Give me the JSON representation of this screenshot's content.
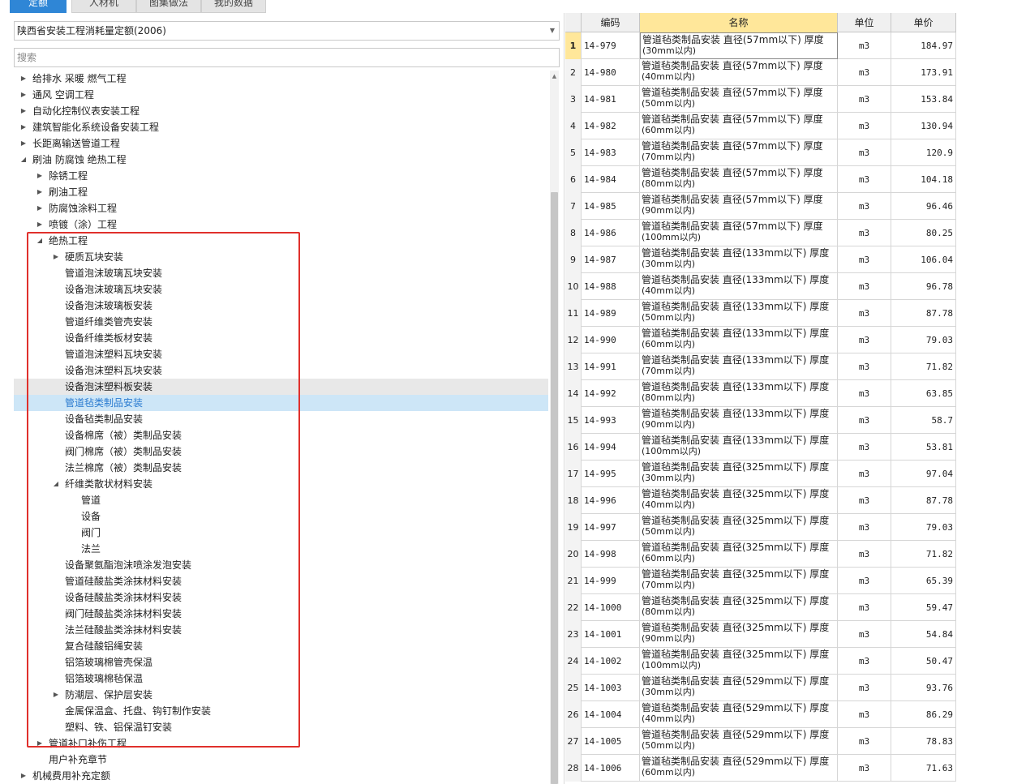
{
  "tabs": [
    {
      "label": "定额",
      "active": true
    },
    {
      "label": "人材机",
      "active": false
    },
    {
      "label": "图集做法",
      "active": false
    },
    {
      "label": "我的数据",
      "active": false
    }
  ],
  "dropdown": {
    "value": "陕西省安装工程消耗量定额(2006)"
  },
  "search": {
    "placeholder": "搜索"
  },
  "tree": [
    {
      "label": "给排水 采暖 燃气工程",
      "level": 0,
      "toggle": "collapsed"
    },
    {
      "label": "通风 空调工程",
      "level": 0,
      "toggle": "collapsed"
    },
    {
      "label": "自动化控制仪表安装工程",
      "level": 0,
      "toggle": "collapsed"
    },
    {
      "label": "建筑智能化系统设备安装工程",
      "level": 0,
      "toggle": "collapsed"
    },
    {
      "label": "长距离输送管道工程",
      "level": 0,
      "toggle": "collapsed"
    },
    {
      "label": "刷油 防腐蚀 绝热工程",
      "level": 0,
      "toggle": "expanded"
    },
    {
      "label": "除锈工程",
      "level": 1,
      "toggle": "collapsed"
    },
    {
      "label": "刷油工程",
      "level": 1,
      "toggle": "collapsed"
    },
    {
      "label": "防腐蚀涂料工程",
      "level": 1,
      "toggle": "collapsed"
    },
    {
      "label": "喷镀（涂）工程",
      "level": 1,
      "toggle": "collapsed"
    },
    {
      "label": "绝热工程",
      "level": 1,
      "toggle": "expanded"
    },
    {
      "label": "硬质瓦块安装",
      "level": 2,
      "toggle": "collapsed"
    },
    {
      "label": "管道泡沫玻璃瓦块安装",
      "level": 2,
      "toggle": "none"
    },
    {
      "label": "设备泡沫玻璃瓦块安装",
      "level": 2,
      "toggle": "none"
    },
    {
      "label": "设备泡沫玻璃板安装",
      "level": 2,
      "toggle": "none"
    },
    {
      "label": "管道纤维类管壳安装",
      "level": 2,
      "toggle": "none"
    },
    {
      "label": "设备纤维类板材安装",
      "level": 2,
      "toggle": "none"
    },
    {
      "label": "管道泡沫塑料瓦块安装",
      "level": 2,
      "toggle": "none"
    },
    {
      "label": "设备泡沫塑料瓦块安装",
      "level": 2,
      "toggle": "none"
    },
    {
      "label": "设备泡沫塑料板安装",
      "level": 2,
      "toggle": "none",
      "state": "hover"
    },
    {
      "label": "管道毡类制品安装",
      "level": 2,
      "toggle": "none",
      "state": "selected"
    },
    {
      "label": "设备毡类制品安装",
      "level": 2,
      "toggle": "none"
    },
    {
      "label": "设备棉席（被）类制品安装",
      "level": 2,
      "toggle": "none"
    },
    {
      "label": "阀门棉席（被）类制品安装",
      "level": 2,
      "toggle": "none"
    },
    {
      "label": "法兰棉席（被）类制品安装",
      "level": 2,
      "toggle": "none"
    },
    {
      "label": "纤维类散状材料安装",
      "level": 2,
      "toggle": "expanded"
    },
    {
      "label": "管道",
      "level": 3,
      "toggle": "none"
    },
    {
      "label": "设备",
      "level": 3,
      "toggle": "none"
    },
    {
      "label": "阀门",
      "level": 3,
      "toggle": "none"
    },
    {
      "label": "法兰",
      "level": 3,
      "toggle": "none"
    },
    {
      "label": "设备聚氨酯泡沫喷涂发泡安装",
      "level": 2,
      "toggle": "none"
    },
    {
      "label": "管道硅酸盐类涂抹材料安装",
      "level": 2,
      "toggle": "none"
    },
    {
      "label": "设备硅酸盐类涂抹材料安装",
      "level": 2,
      "toggle": "none"
    },
    {
      "label": "阀门硅酸盐类涂抹材料安装",
      "level": 2,
      "toggle": "none"
    },
    {
      "label": "法兰硅酸盐类涂抹材料安装",
      "level": 2,
      "toggle": "none"
    },
    {
      "label": "复合硅酸铝绳安装",
      "level": 2,
      "toggle": "none"
    },
    {
      "label": "铝箔玻璃棉管壳保温",
      "level": 2,
      "toggle": "none"
    },
    {
      "label": "铝箔玻璃棉毡保温",
      "level": 2,
      "toggle": "none"
    },
    {
      "label": "防潮层、保护层安装",
      "level": 2,
      "toggle": "collapsed"
    },
    {
      "label": "金属保温盒、托盘、钩钉制作安装",
      "level": 2,
      "toggle": "none"
    },
    {
      "label": "塑料、铁、铝保温钉安装",
      "level": 2,
      "toggle": "none"
    },
    {
      "label": "管道补口补伤工程",
      "level": 1,
      "toggle": "collapsed"
    },
    {
      "label": "用户补充章节",
      "level": 1,
      "toggle": "none"
    },
    {
      "label": "机械费用补充定额",
      "level": 0,
      "toggle": "collapsed"
    }
  ],
  "table": {
    "headers": {
      "index": "",
      "code": "编码",
      "name": "名称",
      "unit": "单位",
      "price": "单价"
    },
    "rows": [
      {
        "index": "1",
        "code": "14-979",
        "name1": "管道毡类制品安装 直径(57mm以下) 厚度",
        "name2": "(30mm以内)",
        "unit": "m3",
        "price": "184.97",
        "active": true
      },
      {
        "index": "2",
        "code": "14-980",
        "name1": "管道毡类制品安装 直径(57mm以下) 厚度",
        "name2": "(40mm以内)",
        "unit": "m3",
        "price": "173.91"
      },
      {
        "index": "3",
        "code": "14-981",
        "name1": "管道毡类制品安装 直径(57mm以下) 厚度",
        "name2": "(50mm以内)",
        "unit": "m3",
        "price": "153.84"
      },
      {
        "index": "4",
        "code": "14-982",
        "name1": "管道毡类制品安装 直径(57mm以下) 厚度",
        "name2": "(60mm以内)",
        "unit": "m3",
        "price": "130.94"
      },
      {
        "index": "5",
        "code": "14-983",
        "name1": "管道毡类制品安装 直径(57mm以下) 厚度",
        "name2": "(70mm以内)",
        "unit": "m3",
        "price": "120.9"
      },
      {
        "index": "6",
        "code": "14-984",
        "name1": "管道毡类制品安装 直径(57mm以下) 厚度",
        "name2": "(80mm以内)",
        "unit": "m3",
        "price": "104.18"
      },
      {
        "index": "7",
        "code": "14-985",
        "name1": "管道毡类制品安装 直径(57mm以下) 厚度",
        "name2": "(90mm以内)",
        "unit": "m3",
        "price": "96.46"
      },
      {
        "index": "8",
        "code": "14-986",
        "name1": "管道毡类制品安装 直径(57mm以下) 厚度",
        "name2": "(100mm以内)",
        "unit": "m3",
        "price": "80.25"
      },
      {
        "index": "9",
        "code": "14-987",
        "name1": "管道毡类制品安装 直径(133mm以下) 厚度",
        "name2": "(30mm以内)",
        "unit": "m3",
        "price": "106.04"
      },
      {
        "index": "10",
        "code": "14-988",
        "name1": "管道毡类制品安装 直径(133mm以下) 厚度",
        "name2": "(40mm以内)",
        "unit": "m3",
        "price": "96.78"
      },
      {
        "index": "11",
        "code": "14-989",
        "name1": "管道毡类制品安装 直径(133mm以下) 厚度",
        "name2": "(50mm以内)",
        "unit": "m3",
        "price": "87.78"
      },
      {
        "index": "12",
        "code": "14-990",
        "name1": "管道毡类制品安装 直径(133mm以下) 厚度",
        "name2": "(60mm以内)",
        "unit": "m3",
        "price": "79.03"
      },
      {
        "index": "13",
        "code": "14-991",
        "name1": "管道毡类制品安装 直径(133mm以下) 厚度",
        "name2": "(70mm以内)",
        "unit": "m3",
        "price": "71.82"
      },
      {
        "index": "14",
        "code": "14-992",
        "name1": "管道毡类制品安装 直径(133mm以下) 厚度",
        "name2": "(80mm以内)",
        "unit": "m3",
        "price": "63.85"
      },
      {
        "index": "15",
        "code": "14-993",
        "name1": "管道毡类制品安装 直径(133mm以下) 厚度",
        "name2": "(90mm以内)",
        "unit": "m3",
        "price": "58.7"
      },
      {
        "index": "16",
        "code": "14-994",
        "name1": "管道毡类制品安装 直径(133mm以下) 厚度",
        "name2": "(100mm以内)",
        "unit": "m3",
        "price": "53.81"
      },
      {
        "index": "17",
        "code": "14-995",
        "name1": "管道毡类制品安装 直径(325mm以下) 厚度",
        "name2": "(30mm以内)",
        "unit": "m3",
        "price": "97.04"
      },
      {
        "index": "18",
        "code": "14-996",
        "name1": "管道毡类制品安装 直径(325mm以下) 厚度",
        "name2": "(40mm以内)",
        "unit": "m3",
        "price": "87.78"
      },
      {
        "index": "19",
        "code": "14-997",
        "name1": "管道毡类制品安装 直径(325mm以下) 厚度",
        "name2": "(50mm以内)",
        "unit": "m3",
        "price": "79.03"
      },
      {
        "index": "20",
        "code": "14-998",
        "name1": "管道毡类制品安装 直径(325mm以下) 厚度",
        "name2": "(60mm以内)",
        "unit": "m3",
        "price": "71.82"
      },
      {
        "index": "21",
        "code": "14-999",
        "name1": "管道毡类制品安装 直径(325mm以下) 厚度",
        "name2": "(70mm以内)",
        "unit": "m3",
        "price": "65.39"
      },
      {
        "index": "22",
        "code": "14-1000",
        "name1": "管道毡类制品安装 直径(325mm以下) 厚度",
        "name2": "(80mm以内)",
        "unit": "m3",
        "price": "59.47"
      },
      {
        "index": "23",
        "code": "14-1001",
        "name1": "管道毡类制品安装 直径(325mm以下) 厚度",
        "name2": "(90mm以内)",
        "unit": "m3",
        "price": "54.84"
      },
      {
        "index": "24",
        "code": "14-1002",
        "name1": "管道毡类制品安装 直径(325mm以下) 厚度",
        "name2": "(100mm以内)",
        "unit": "m3",
        "price": "50.47"
      },
      {
        "index": "25",
        "code": "14-1003",
        "name1": "管道毡类制品安装 直径(529mm以下) 厚度",
        "name2": "(30mm以内)",
        "unit": "m3",
        "price": "93.76"
      },
      {
        "index": "26",
        "code": "14-1004",
        "name1": "管道毡类制品安装 直径(529mm以下) 厚度",
        "name2": "(40mm以内)",
        "unit": "m3",
        "price": "86.29"
      },
      {
        "index": "27",
        "code": "14-1005",
        "name1": "管道毡类制品安装 直径(529mm以下) 厚度",
        "name2": "(50mm以内)",
        "unit": "m3",
        "price": "78.83"
      },
      {
        "index": "28",
        "code": "14-1006",
        "name1": "管道毡类制品安装 直径(529mm以下) 厚度",
        "name2": "(60mm以内)",
        "unit": "m3",
        "price": "71.63"
      }
    ]
  },
  "colors": {
    "accent": "#2f86d6",
    "selected_bg": "#cde6f7",
    "header_name_bg": "#ffe79a",
    "highlight_box": "#e0302c"
  }
}
